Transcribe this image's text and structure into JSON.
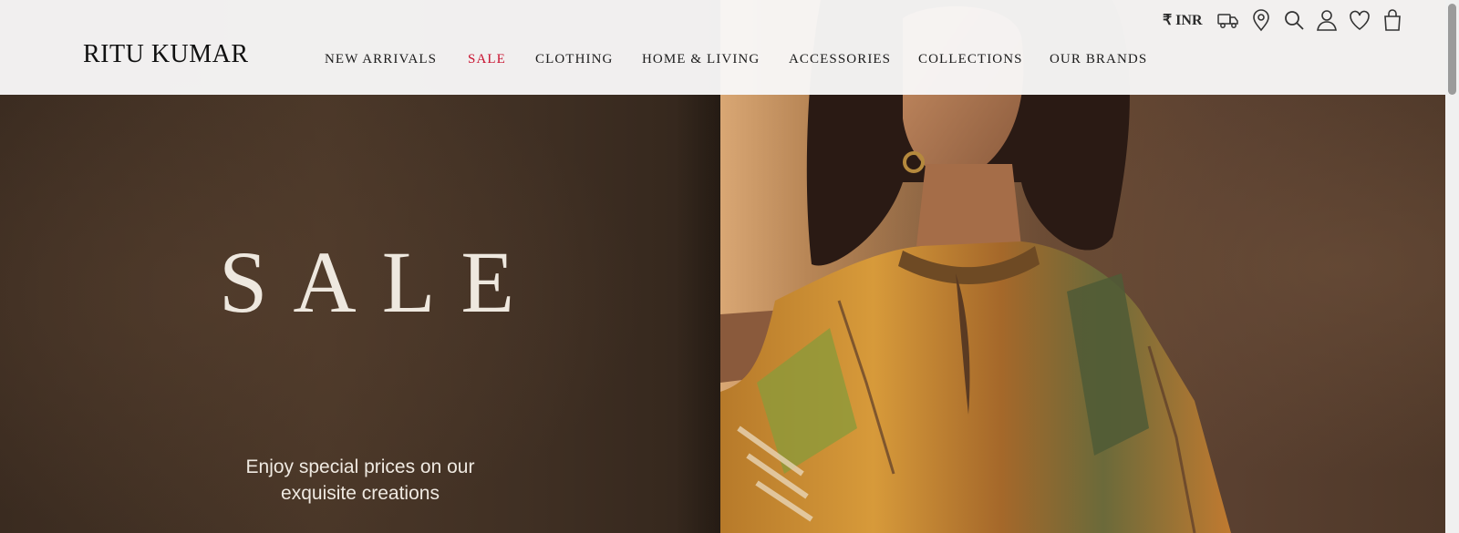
{
  "header": {
    "logo": "RITU KUMAR",
    "nav": [
      {
        "label": "NEW ARRIVALS"
      },
      {
        "label": "SALE"
      },
      {
        "label": "CLOTHING"
      },
      {
        "label": "HOME & LIVING"
      },
      {
        "label": "ACCESSORIES"
      },
      {
        "label": "COLLECTIONS"
      },
      {
        "label": "OUR BRANDS"
      }
    ],
    "currency": "₹ INR",
    "icons": [
      "truck-icon",
      "location-pin-icon",
      "search-icon",
      "user-icon",
      "heart-icon",
      "shopping-bag-icon"
    ]
  },
  "hero": {
    "title": "SALE",
    "subtitle_line1": "Enjoy special prices on our",
    "subtitle_line2": "exquisite creations"
  },
  "colors": {
    "sale_accent": "#c8102e",
    "header_bg": "#f8f7f7",
    "hero_text": "#eee8df"
  }
}
